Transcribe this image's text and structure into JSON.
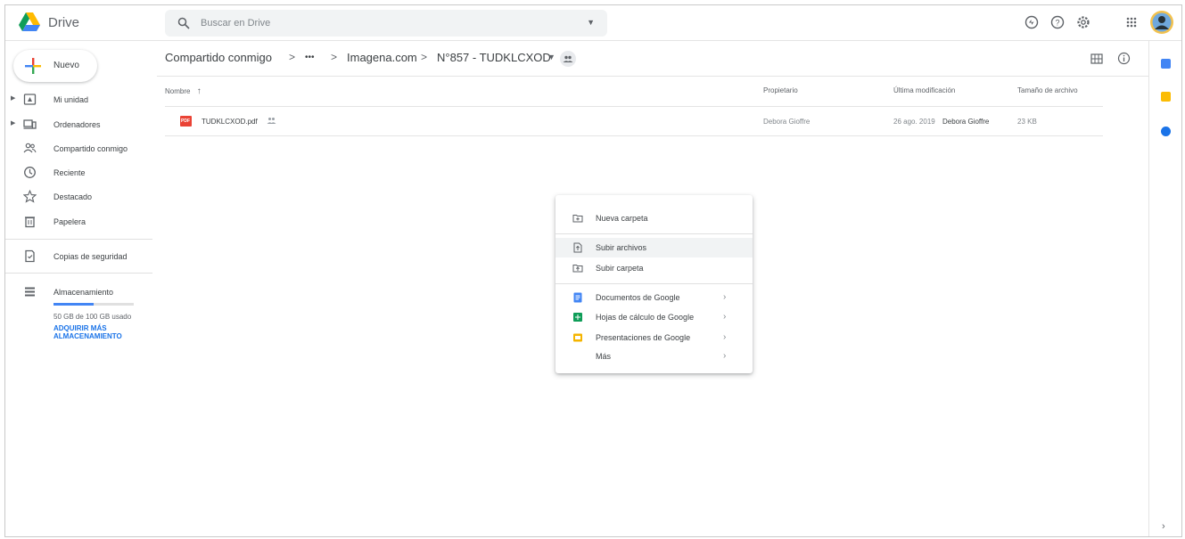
{
  "app": {
    "name": "Drive"
  },
  "search": {
    "placeholder": "Buscar en Drive"
  },
  "sidebar": {
    "new_label": "Nuevo",
    "items": [
      {
        "label": "Mi unidad"
      },
      {
        "label": "Ordenadores"
      },
      {
        "label": "Compartido conmigo"
      },
      {
        "label": "Reciente"
      },
      {
        "label": "Destacado"
      },
      {
        "label": "Papelera"
      },
      {
        "label": "Copias de seguridad"
      },
      {
        "label": "Almacenamiento"
      }
    ],
    "storage_used_fraction": 0.5,
    "storage_text": "50 GB de 100 GB usado",
    "buy_line1": "ADQUIRIR MÁS",
    "buy_line2": "ALMACENAMIENTO"
  },
  "breadcrumb": {
    "root": "Compartido conmigo",
    "ellipsis": "•••",
    "middle": "Imagena.com",
    "current": "N°857 - TUDKLCXOD"
  },
  "table": {
    "headers": {
      "name": "Nombre",
      "owner": "Propietario",
      "modified": "Última modificación",
      "size": "Tamaño de archivo"
    },
    "rows": [
      {
        "name": "TUDKLCXOD.pdf",
        "owner": "Debora Gioffre",
        "modified_date": "26 ago. 2019",
        "modified_by": "Debora Gioffre",
        "size": "23 KB"
      }
    ]
  },
  "menu": {
    "new_folder": "Nueva carpeta",
    "upload_files": "Subir archivos",
    "upload_folder": "Subir carpeta",
    "docs": "Documentos de Google",
    "sheets": "Hojas de cálculo de Google",
    "slides": "Presentaciones de Google",
    "more": "Más",
    "chevron": "›"
  },
  "colors": {
    "accent_blue": "#4285f4",
    "docs_blue": "#4285f4",
    "sheets_green": "#0f9d58",
    "slides_yellow": "#f4b400",
    "pdf_red": "#ea4335"
  }
}
